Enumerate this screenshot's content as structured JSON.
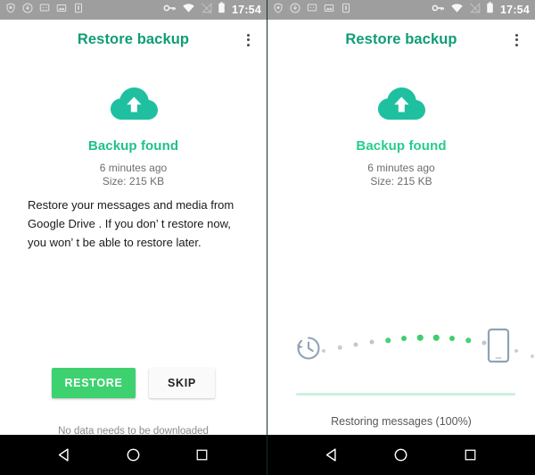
{
  "statusbar": {
    "time": "17:54",
    "left_icons": [
      "shield-icon",
      "download-icon",
      "message-icon",
      "image-icon",
      "sim-icon"
    ],
    "right_icons": [
      "vpn-key-icon",
      "wifi-icon",
      "signal-off-icon",
      "battery-icon"
    ]
  },
  "appbar": {
    "title": "Restore backup",
    "overflow_label": "More options"
  },
  "left_screen": {
    "cloud_icon": "cloud-upload-icon",
    "backup_found": "Backup found",
    "time_ago": "6 minutes ago",
    "size": "Size: 215 KB",
    "description": "Restore your messages and media from Google Drive . If you don’ t restore now, you won’ t be able to restore later.",
    "restore_label": "RESTORE",
    "skip_label": "SKIP",
    "footnote": "No data needs to be downloaded"
  },
  "right_screen": {
    "cloud_icon": "cloud-upload-icon",
    "backup_found": "Backup found",
    "time_ago": "6 minutes ago",
    "size": "Size: 215 KB",
    "history_icon": "restore-history-icon",
    "device_icon": "smartphone-icon",
    "progress_label": "Restoring messages (100%)",
    "progress_percent": 100,
    "dots": [
      {
        "state": "inactive"
      },
      {
        "state": "inactive"
      },
      {
        "state": "inactive"
      },
      {
        "state": "inactive"
      },
      {
        "state": "active"
      },
      {
        "state": "active"
      },
      {
        "state": "active"
      },
      {
        "state": "active"
      },
      {
        "state": "active"
      },
      {
        "state": "active"
      },
      {
        "state": "inactive"
      },
      {
        "state": "inactive"
      },
      {
        "state": "inactive"
      },
      {
        "state": "inactive"
      }
    ]
  },
  "navbar": {
    "back_label": "Back",
    "home_label": "Home",
    "recents_label": "Recents"
  },
  "colors": {
    "title_green": "#0f9d74",
    "accent_green": "#1fc08a",
    "button_green": "#3ed16f",
    "cloud_teal": "#1fc0a0",
    "dot_active": "#3ecf6d",
    "dot_inactive": "#c7cdd4",
    "statusbar_gray": "#9e9e9e",
    "progress_fill": "#cdf0dc"
  }
}
